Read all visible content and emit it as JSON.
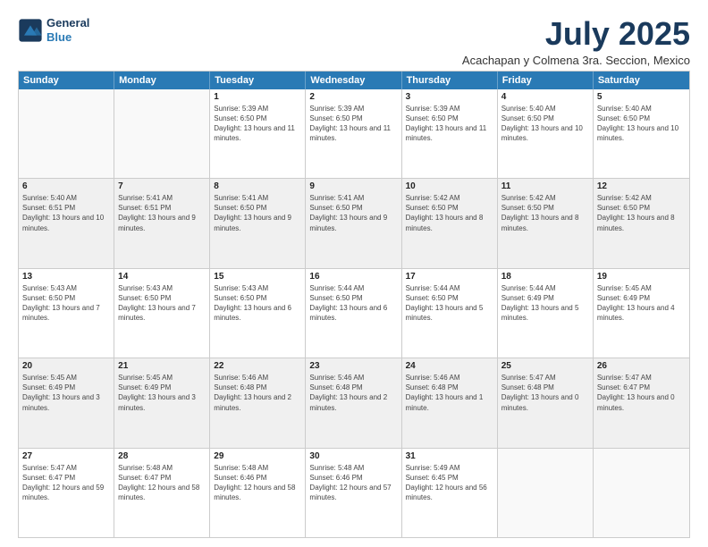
{
  "logo": {
    "line1": "General",
    "line2": "Blue"
  },
  "title": "July 2025",
  "location": "Acachapan y Colmena 3ra. Seccion, Mexico",
  "weekdays": [
    "Sunday",
    "Monday",
    "Tuesday",
    "Wednesday",
    "Thursday",
    "Friday",
    "Saturday"
  ],
  "weeks": [
    [
      {
        "day": "",
        "info": "",
        "empty": true
      },
      {
        "day": "",
        "info": "",
        "empty": true
      },
      {
        "day": "1",
        "info": "Sunrise: 5:39 AM\nSunset: 6:50 PM\nDaylight: 13 hours and 11 minutes."
      },
      {
        "day": "2",
        "info": "Sunrise: 5:39 AM\nSunset: 6:50 PM\nDaylight: 13 hours and 11 minutes."
      },
      {
        "day": "3",
        "info": "Sunrise: 5:39 AM\nSunset: 6:50 PM\nDaylight: 13 hours and 11 minutes."
      },
      {
        "day": "4",
        "info": "Sunrise: 5:40 AM\nSunset: 6:50 PM\nDaylight: 13 hours and 10 minutes."
      },
      {
        "day": "5",
        "info": "Sunrise: 5:40 AM\nSunset: 6:50 PM\nDaylight: 13 hours and 10 minutes."
      }
    ],
    [
      {
        "day": "6",
        "info": "Sunrise: 5:40 AM\nSunset: 6:51 PM\nDaylight: 13 hours and 10 minutes.",
        "shaded": true
      },
      {
        "day": "7",
        "info": "Sunrise: 5:41 AM\nSunset: 6:51 PM\nDaylight: 13 hours and 9 minutes.",
        "shaded": true
      },
      {
        "day": "8",
        "info": "Sunrise: 5:41 AM\nSunset: 6:50 PM\nDaylight: 13 hours and 9 minutes.",
        "shaded": true
      },
      {
        "day": "9",
        "info": "Sunrise: 5:41 AM\nSunset: 6:50 PM\nDaylight: 13 hours and 9 minutes.",
        "shaded": true
      },
      {
        "day": "10",
        "info": "Sunrise: 5:42 AM\nSunset: 6:50 PM\nDaylight: 13 hours and 8 minutes.",
        "shaded": true
      },
      {
        "day": "11",
        "info": "Sunrise: 5:42 AM\nSunset: 6:50 PM\nDaylight: 13 hours and 8 minutes.",
        "shaded": true
      },
      {
        "day": "12",
        "info": "Sunrise: 5:42 AM\nSunset: 6:50 PM\nDaylight: 13 hours and 8 minutes.",
        "shaded": true
      }
    ],
    [
      {
        "day": "13",
        "info": "Sunrise: 5:43 AM\nSunset: 6:50 PM\nDaylight: 13 hours and 7 minutes."
      },
      {
        "day": "14",
        "info": "Sunrise: 5:43 AM\nSunset: 6:50 PM\nDaylight: 13 hours and 7 minutes."
      },
      {
        "day": "15",
        "info": "Sunrise: 5:43 AM\nSunset: 6:50 PM\nDaylight: 13 hours and 6 minutes."
      },
      {
        "day": "16",
        "info": "Sunrise: 5:44 AM\nSunset: 6:50 PM\nDaylight: 13 hours and 6 minutes."
      },
      {
        "day": "17",
        "info": "Sunrise: 5:44 AM\nSunset: 6:50 PM\nDaylight: 13 hours and 5 minutes."
      },
      {
        "day": "18",
        "info": "Sunrise: 5:44 AM\nSunset: 6:49 PM\nDaylight: 13 hours and 5 minutes."
      },
      {
        "day": "19",
        "info": "Sunrise: 5:45 AM\nSunset: 6:49 PM\nDaylight: 13 hours and 4 minutes."
      }
    ],
    [
      {
        "day": "20",
        "info": "Sunrise: 5:45 AM\nSunset: 6:49 PM\nDaylight: 13 hours and 3 minutes.",
        "shaded": true
      },
      {
        "day": "21",
        "info": "Sunrise: 5:45 AM\nSunset: 6:49 PM\nDaylight: 13 hours and 3 minutes.",
        "shaded": true
      },
      {
        "day": "22",
        "info": "Sunrise: 5:46 AM\nSunset: 6:48 PM\nDaylight: 13 hours and 2 minutes.",
        "shaded": true
      },
      {
        "day": "23",
        "info": "Sunrise: 5:46 AM\nSunset: 6:48 PM\nDaylight: 13 hours and 2 minutes.",
        "shaded": true
      },
      {
        "day": "24",
        "info": "Sunrise: 5:46 AM\nSunset: 6:48 PM\nDaylight: 13 hours and 1 minute.",
        "shaded": true
      },
      {
        "day": "25",
        "info": "Sunrise: 5:47 AM\nSunset: 6:48 PM\nDaylight: 13 hours and 0 minutes.",
        "shaded": true
      },
      {
        "day": "26",
        "info": "Sunrise: 5:47 AM\nSunset: 6:47 PM\nDaylight: 13 hours and 0 minutes.",
        "shaded": true
      }
    ],
    [
      {
        "day": "27",
        "info": "Sunrise: 5:47 AM\nSunset: 6:47 PM\nDaylight: 12 hours and 59 minutes."
      },
      {
        "day": "28",
        "info": "Sunrise: 5:48 AM\nSunset: 6:47 PM\nDaylight: 12 hours and 58 minutes."
      },
      {
        "day": "29",
        "info": "Sunrise: 5:48 AM\nSunset: 6:46 PM\nDaylight: 12 hours and 58 minutes."
      },
      {
        "day": "30",
        "info": "Sunrise: 5:48 AM\nSunset: 6:46 PM\nDaylight: 12 hours and 57 minutes."
      },
      {
        "day": "31",
        "info": "Sunrise: 5:49 AM\nSunset: 6:45 PM\nDaylight: 12 hours and 56 minutes."
      },
      {
        "day": "",
        "info": "",
        "empty": true
      },
      {
        "day": "",
        "info": "",
        "empty": true
      }
    ]
  ]
}
